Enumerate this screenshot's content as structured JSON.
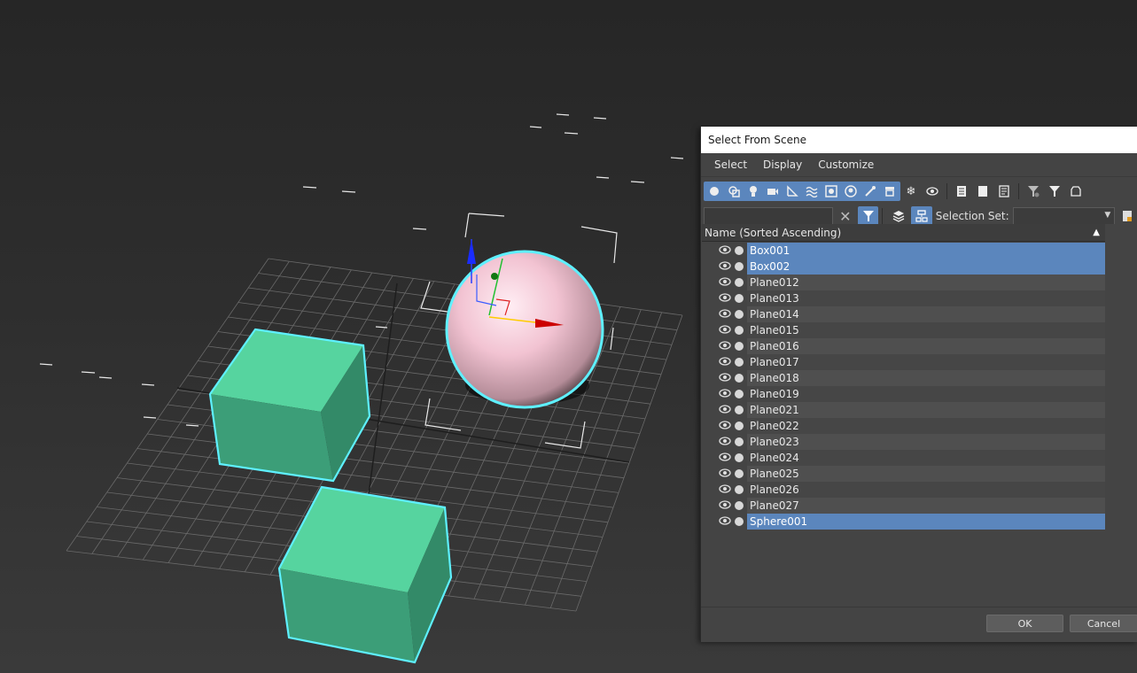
{
  "dialog": {
    "title": "Select From Scene",
    "menu": [
      "Select",
      "Display",
      "Customize"
    ],
    "toolbar_icons": [
      "geometry-icon",
      "shapes-icon",
      "lights-icon",
      "cameras-icon",
      "helpers-icon",
      "spacewarps-icon",
      "groups-icon",
      "xrefs-icon",
      "bones-icon",
      "containers-icon",
      "frozen-icon",
      "hidden-icon",
      "select-all-icon",
      "select-none-icon",
      "select-invert-icon",
      "filter-clear-icon",
      "filter-icon",
      "layers-icon"
    ],
    "filter": {
      "search_value": "",
      "selection_set_label": "Selection Set:",
      "selection_set_value": ""
    },
    "list_header": "Name (Sorted Ascending)",
    "sort_arrow": "▲",
    "items": [
      {
        "name": "Box001",
        "selected": true
      },
      {
        "name": "Box002",
        "selected": true
      },
      {
        "name": "Plane012",
        "selected": false
      },
      {
        "name": "Plane013",
        "selected": false
      },
      {
        "name": "Plane014",
        "selected": false
      },
      {
        "name": "Plane015",
        "selected": false
      },
      {
        "name": "Plane016",
        "selected": false
      },
      {
        "name": "Plane017",
        "selected": false
      },
      {
        "name": "Plane018",
        "selected": false
      },
      {
        "name": "Plane019",
        "selected": false
      },
      {
        "name": "Plane021",
        "selected": false
      },
      {
        "name": "Plane022",
        "selected": false
      },
      {
        "name": "Plane023",
        "selected": false
      },
      {
        "name": "Plane024",
        "selected": false
      },
      {
        "name": "Plane025",
        "selected": false
      },
      {
        "name": "Plane026",
        "selected": false
      },
      {
        "name": "Plane027",
        "selected": false
      },
      {
        "name": "Sphere001",
        "selected": true
      }
    ],
    "ok_label": "OK",
    "cancel_label": "Cancel"
  },
  "colors": {
    "selection": "#5b86bd",
    "box_face": "#4fcb96",
    "box_highlight": "#5ef0ff",
    "sphere": "#f4c6d4",
    "grid": "#6a6a6a"
  }
}
